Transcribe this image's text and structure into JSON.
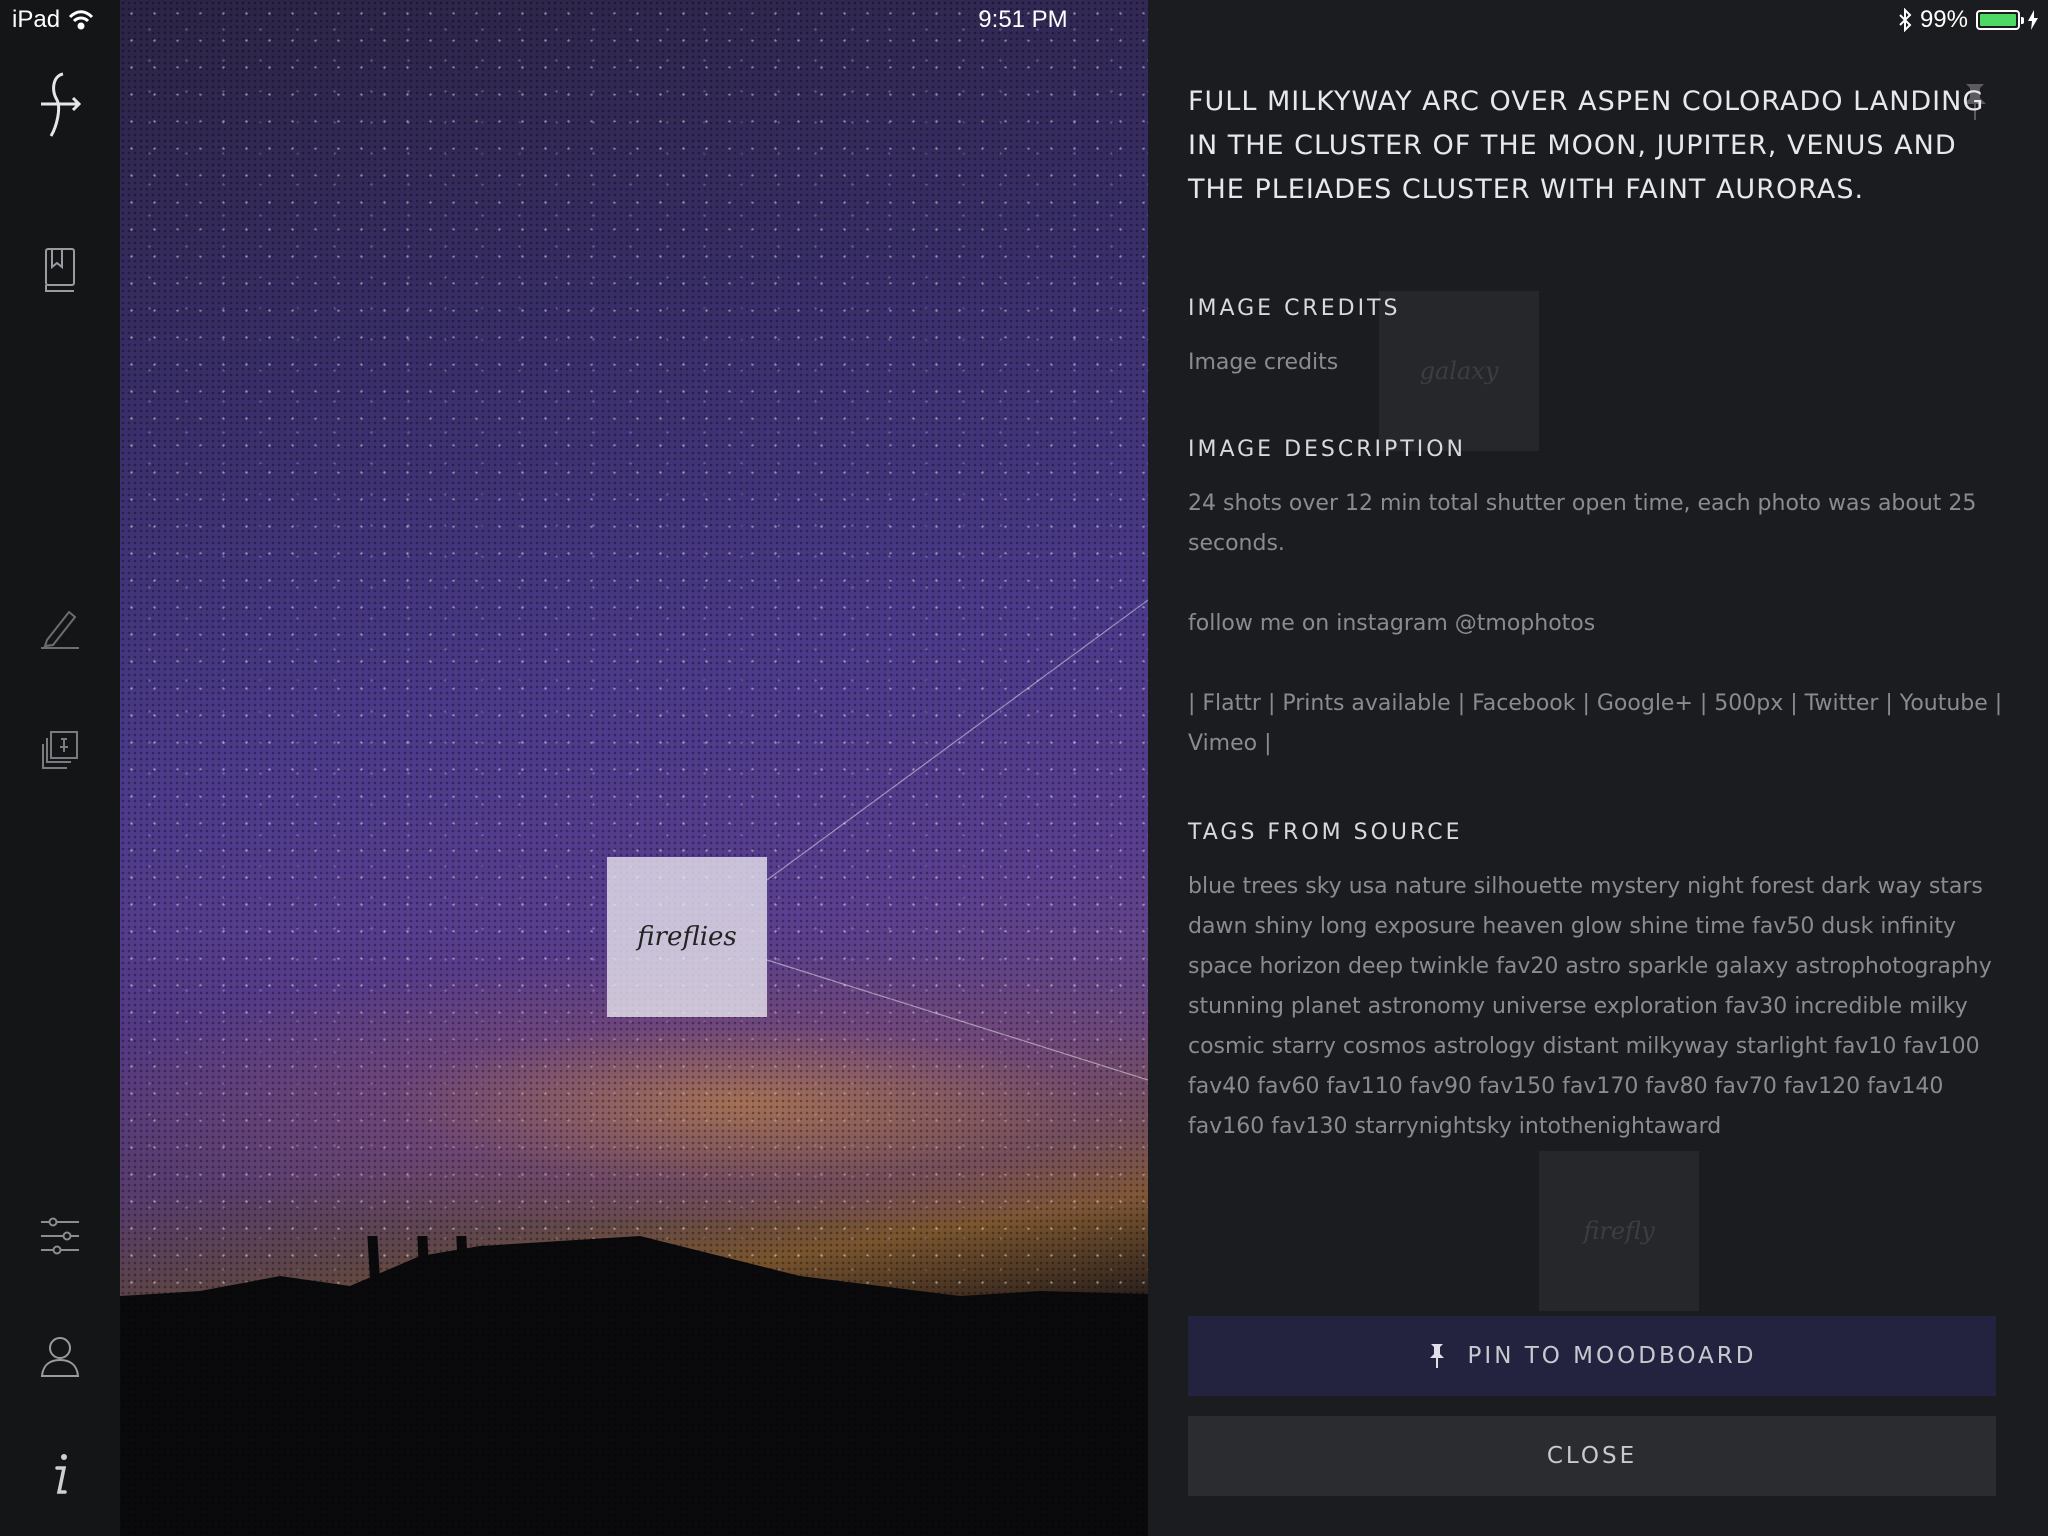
{
  "status_bar": {
    "device": "iPad",
    "time": "9:51 PM",
    "battery_percent": "99%",
    "battery_level": 0.99,
    "icons": [
      "wifi-icon",
      "bluetooth-icon",
      "battery-icon",
      "charging-icon"
    ]
  },
  "sidebar": {
    "items": [
      {
        "name": "logo",
        "icon": "app-logo-icon"
      },
      {
        "name": "library",
        "icon": "book-icon"
      },
      {
        "name": "draw",
        "icon": "pencil-icon"
      },
      {
        "name": "moodboards",
        "icon": "pinned-stack-icon"
      },
      {
        "name": "filters",
        "icon": "sliders-icon"
      },
      {
        "name": "profile",
        "icon": "user-icon"
      },
      {
        "name": "info",
        "icon": "info-icon"
      }
    ]
  },
  "photo": {
    "tag_label": "fireflies",
    "ghost_tags": [
      "galaxy",
      "firefly"
    ]
  },
  "panel": {
    "title": "FULL MILKYWAY ARC OVER ASPEN COLORADO LANDING IN THE CLUSTER OF THE MOON, JUPITER, VENUS AND THE   PLEIADES CLUSTER WITH FAINT AURORAS.",
    "credits_heading": "IMAGE CREDITS",
    "credits_text": "Image credits",
    "description_heading": "IMAGE DESCRIPTION",
    "description_lines": [
      "24 shots over 12 min total shutter open time, each photo was about 25 seconds.",
      "follow me on instagram @tmophotos",
      "| Flattr | Prints available | Facebook  | Google+ | 500px | Twitter | Youtube  | Vimeo |"
    ],
    "tags_heading": "TAGS FROM SOURCE",
    "tags_text": "blue trees sky usa nature silhouette mystery night forest dark way stars dawn shiny long exposure heaven glow shine time fav50 dusk infinity space horizon deep twinkle fav20 astro sparkle galaxy astrophotography stunning planet astronomy universe exploration fav30 incredible milky cosmic starry cosmos astrology distant milkyway starlight fav10 fav100 fav40 fav60 fav110 fav90 fav150 fav170 fav80 fav70 fav120 fav140 fav160 fav130 starrynightsky intothenightaward"
  },
  "buttons": {
    "pin_label": "PIN TO MOODBOARD",
    "close_label": "CLOSE"
  },
  "colors": {
    "sidebar_bg": "#141517",
    "panel_bg": "#1b1c20",
    "pin_button_bg": "#23233f",
    "close_button_bg": "#2b2c30",
    "battery_green": "#4cd964"
  }
}
